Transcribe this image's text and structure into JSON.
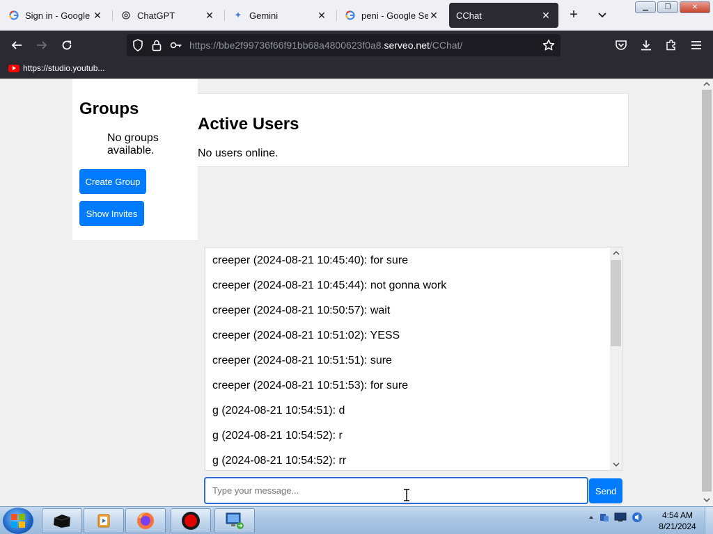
{
  "browser": {
    "tabs": [
      {
        "title": "Sign in - Google Ac",
        "icon": "google-icon",
        "active": false
      },
      {
        "title": "ChatGPT",
        "icon": "chatgpt-icon",
        "active": false
      },
      {
        "title": "Gemini",
        "icon": "gemini-icon",
        "active": false
      },
      {
        "title": "peni - Google Searc",
        "icon": "google-icon",
        "active": false
      },
      {
        "title": "CChat",
        "icon": "",
        "active": true
      }
    ],
    "url_prefix": "https://bbe2f99736f66f91bb68a4800623f0a8.",
    "url_domain": "serveo.net",
    "url_path": "/CChat/",
    "bookmark": "https://studio.youtub..."
  },
  "sidebar": {
    "title": "Groups",
    "empty_text": "No groups available.",
    "create_button": "Create Group",
    "invites_button": "Show Invites"
  },
  "users": {
    "title": "Active Users",
    "empty_text": "No users online."
  },
  "chat": {
    "messages": [
      "creeper (2024-08-21 10:45:40): for sure",
      "creeper (2024-08-21 10:45:44): not gonna work",
      "creeper (2024-08-21 10:50:57): wait",
      "creeper (2024-08-21 10:51:02): YESS",
      "creeper (2024-08-21 10:51:51): sure",
      "creeper (2024-08-21 10:51:53): for sure",
      "g (2024-08-21 10:54:51): d",
      "g (2024-08-21 10:54:52): r",
      "g (2024-08-21 10:54:52): rr"
    ],
    "input_placeholder": "Type your message...",
    "send_label": "Send"
  },
  "taskbar": {
    "time": "4:54 AM",
    "date": "8/21/2024"
  },
  "colors": {
    "accent": "#007bff",
    "browser_chrome": "#2b2a33",
    "input_focus": "#2a6fd6"
  }
}
